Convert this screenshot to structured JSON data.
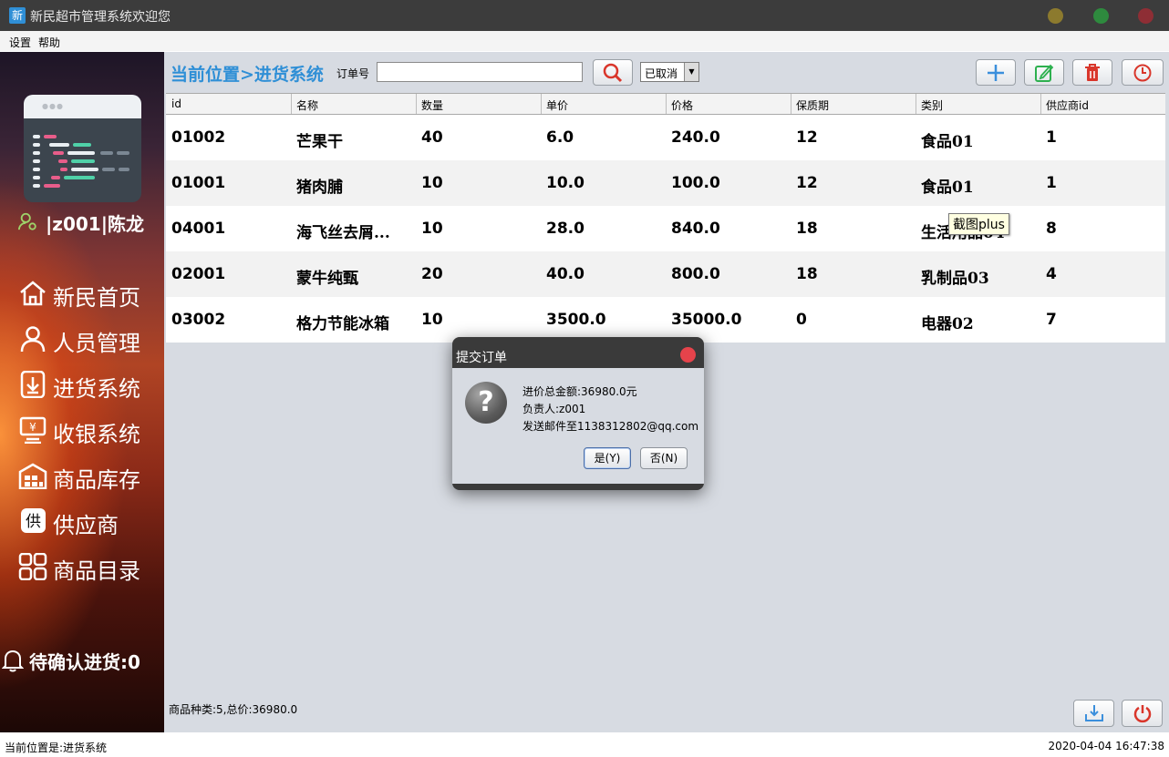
{
  "window": {
    "title": "新民超市管理系统欢迎您",
    "app_icon": "新"
  },
  "menu": [
    "设置",
    "帮助"
  ],
  "sidebar": {
    "user": "|z001|陈龙",
    "nav": [
      {
        "label": "新民首页",
        "icon": "home-icon"
      },
      {
        "label": "人员管理",
        "icon": "person-icon"
      },
      {
        "label": "进货系统",
        "icon": "download-box-icon"
      },
      {
        "label": "收银系统",
        "icon": "cashier-icon"
      },
      {
        "label": "商品库存",
        "icon": "warehouse-icon"
      },
      {
        "label": "供应商",
        "icon": "supplier-icon"
      },
      {
        "label": "商品目录",
        "icon": "grid-icon"
      }
    ],
    "pending": "待确认进货:0"
  },
  "toolbar": {
    "location": "当前位置>进货系统",
    "order_label": "订单号",
    "order_value": "",
    "status_select": "已取消"
  },
  "table": {
    "headers": [
      "id",
      "名称",
      "数量",
      "单价",
      "价格",
      "保质期",
      "类别",
      "供应商id"
    ],
    "rows": [
      [
        "01002",
        "芒果干",
        "40",
        "6.0",
        "240.0",
        "12",
        "食品01",
        "1"
      ],
      [
        "01001",
        "猪肉脯",
        "10",
        "10.0",
        "100.0",
        "12",
        "食品01",
        "1"
      ],
      [
        "04001",
        "海飞丝去屑...",
        "10",
        "28.0",
        "840.0",
        "18",
        "生活用品04",
        "8"
      ],
      [
        "02001",
        "蒙牛纯甄",
        "20",
        "40.0",
        "800.0",
        "18",
        "乳制品03",
        "4"
      ],
      [
        "03002",
        "格力节能冰箱",
        "10",
        "3500.0",
        "35000.0",
        "0",
        "电器02",
        "7"
      ]
    ]
  },
  "tooltip": "截图plus",
  "dialog": {
    "title": "提交订单",
    "lines": [
      "进价总金额:36980.0元",
      "负责人:z001",
      "发送邮件至1138312802@qq.com"
    ],
    "yes_label": "是(Y)",
    "no_label": "否(N)"
  },
  "summary": "商品种类:5,总价:36980.0",
  "status": {
    "left": "当前位置是:进货系统",
    "right": "2020-04-04 16:47:38"
  },
  "colors": {
    "accent": "#2f8fd6",
    "title_bar": "#3c3c3c",
    "dialog_close": "#e5434b"
  }
}
